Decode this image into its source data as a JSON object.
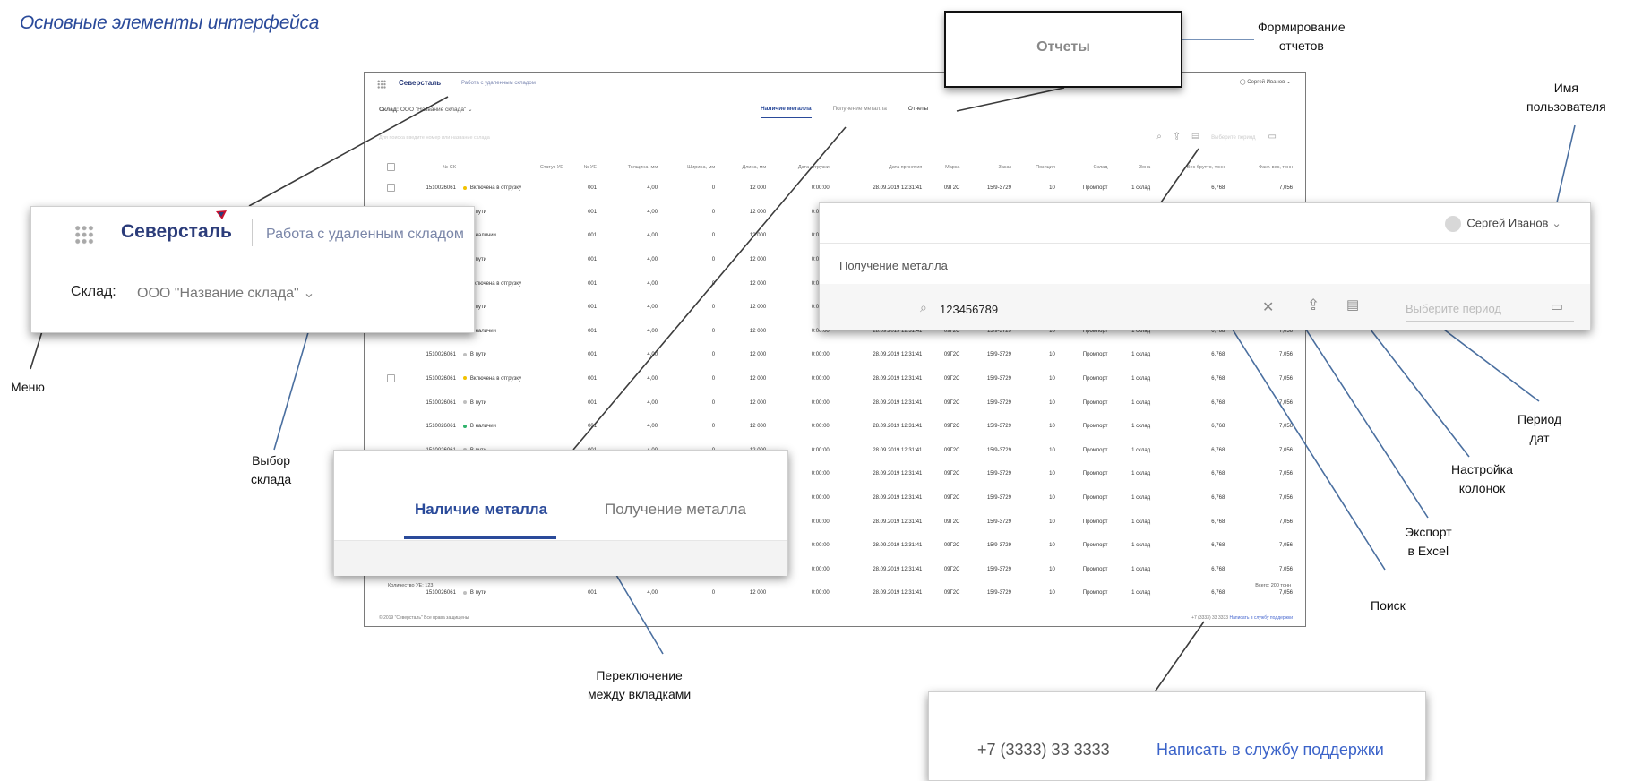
{
  "page": {
    "title": "Основные элементы интерфейса"
  },
  "callouts": {
    "reports": "Формирование\nотчетов",
    "username": "Имя\nпользователя",
    "menu": "Меню",
    "warehouse": "Выбор\nсклада",
    "period": "Период\nдат",
    "columns": "Настройка\nколонок",
    "export": "Экспорт\nв Excel",
    "search": "Поиск",
    "tabs": "Переключение\nмежду вкладками"
  },
  "app": {
    "brand": "Северсталь",
    "subtitle": "Работа с удаленным складом",
    "user": "Сергей Иванов",
    "warehouse_label": "Склад:",
    "warehouse_value": "ООО \"Название склада\"",
    "tabs": [
      "Наличие металла",
      "Получение металла",
      "Отчеты"
    ],
    "search_placeholder": "Для поиска введите номер или название склада",
    "period_placeholder": "Выберите период",
    "columns": [
      "№ СК",
      "Статус УЕ",
      "№ УЕ",
      "Толщина, мм",
      "Ширина, мм",
      "Длина, мм",
      "Дата отгрузки",
      "Дата принятия",
      "Марка",
      "Заказ",
      "Позиция",
      "Склад",
      "Зона",
      "Вес брутто, тонн",
      "Факт. вес, тонн"
    ],
    "rows": [
      {
        "sk": "1510026061",
        "status": "Включена в отгрузку",
        "color": "#f2c200"
      },
      {
        "sk": "1510026061",
        "status": "В пути",
        "color": "#bfbfbf"
      },
      {
        "sk": "1510026061",
        "status": "В наличии",
        "color": "#2fb36b"
      },
      {
        "sk": "1510026061",
        "status": "В пути",
        "color": "#bfbfbf"
      },
      {
        "sk": "1510026061",
        "status": "Включена в отгрузку",
        "color": "#f2c200"
      },
      {
        "sk": "1510026061",
        "status": "В пути",
        "color": "#bfbfbf"
      },
      {
        "sk": "1510026061",
        "status": "В наличии",
        "color": "#2fb36b"
      },
      {
        "sk": "1510026061",
        "status": "В пути",
        "color": "#bfbfbf"
      },
      {
        "sk": "1510026061",
        "status": "Включена в отгрузку",
        "color": "#f2c200"
      },
      {
        "sk": "1510026061",
        "status": "В пути",
        "color": "#bfbfbf"
      },
      {
        "sk": "1510026061",
        "status": "В наличии",
        "color": "#2fb36b"
      },
      {
        "sk": "1510026061",
        "status": "В пути",
        "color": "#bfbfbf"
      },
      {
        "sk": "1510026061",
        "status": "Включена в отгрузку",
        "color": "#f2c200"
      },
      {
        "sk": "1510026061",
        "status": "В пути",
        "color": "#bfbfbf"
      },
      {
        "sk": "1510026061",
        "status": "В наличии",
        "color": "#2fb36b"
      },
      {
        "sk": "1510026061",
        "status": "В пути",
        "color": "#bfbfbf"
      },
      {
        "sk": "1510026061",
        "status": "В наличии",
        "color": "#2fb36b"
      },
      {
        "sk": "1510026061",
        "status": "В пути",
        "color": "#bfbfbf"
      }
    ],
    "row_values": {
      "ue": "001",
      "thickness": "4,00",
      "width": "0",
      "length": "12 000",
      "ship_date": "0:00:00",
      "accept_date": "28.09.2019 12:31:41",
      "grade": "09Г2С",
      "order": "15/9-3729",
      "position": "10",
      "store": "Промпорт",
      "zone": "1 склад",
      "gross": "6,768",
      "fact": "7,056"
    },
    "count": "Количество УЕ: 123",
    "total": "Всего: 200 тонн",
    "copyright": "© 2019 \"Северсталь\" Все права защищены",
    "phone": "+7 (3333) 33 3333",
    "support": "Написать в службу поддержки"
  },
  "zoom": {
    "reports": "Отчеты",
    "tab_active": "Наличие металла",
    "tab_other": "Получение металла",
    "search_value": "123456789",
    "user_tab": "Получение металла"
  },
  "colors": {
    "accent": "#2a4a9a",
    "brand": "#2b3c7a",
    "link": "#3b63c9",
    "logo_red": "#c8102e"
  }
}
